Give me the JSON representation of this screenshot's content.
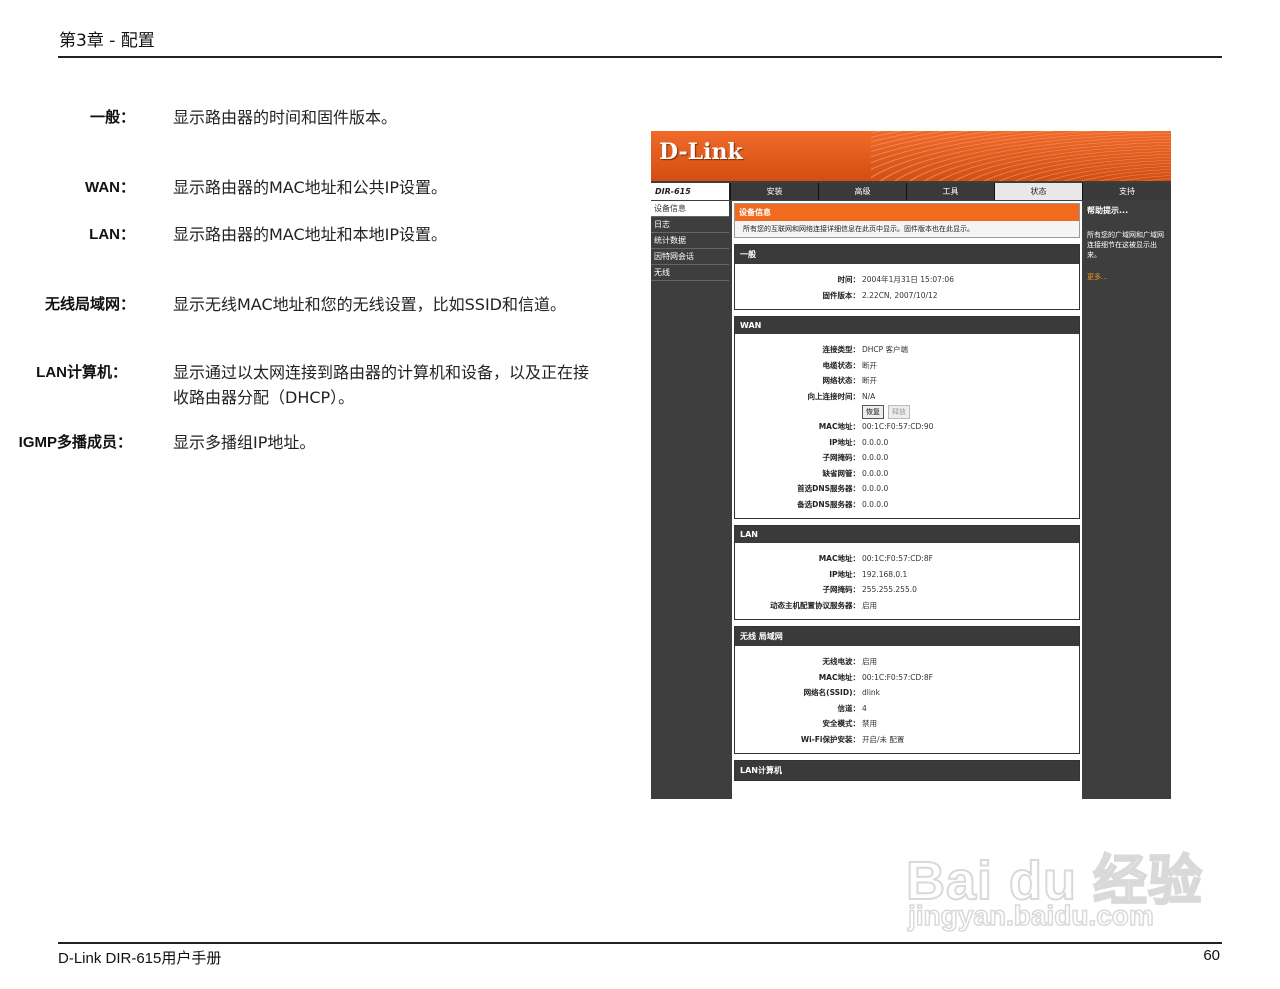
{
  "header": {
    "chapter": "第3章 - 配置"
  },
  "descriptions": [
    {
      "term": "一般：",
      "text": "显示路由器的时间和固件版本。"
    },
    {
      "term": "WAN：",
      "text": "显示路由器的MAC地址和公共IP设置。"
    },
    {
      "term": "LAN：",
      "text": "显示路由器的MAC地址和本地IP设置。"
    },
    {
      "term": "无线局域网：",
      "text": "显示无线MAC地址和您的无线设置，比如SSID和信道。"
    },
    {
      "term": "LAN计算机：",
      "text": "显示通过以太网连接到路由器的计算机和设备，以及正在接收路由器分配（DHCP）。"
    },
    {
      "term": "IGMP多播成员：",
      "text": "显示多播组IP地址。"
    }
  ],
  "router_ui": {
    "logo": "D-Link",
    "model": "DIR-615",
    "tabs": [
      "安装",
      "高级",
      "工具",
      "状态",
      "支持"
    ],
    "active_tab": "状态",
    "menu": [
      "设备信息",
      "日志",
      "统计数据",
      "因特网会话",
      "无线"
    ],
    "info_title": "设备信息",
    "info_text": "所有您的互联网和网络连接详细信息在此页中显示。固件版本也在此显示。",
    "help_title": "帮助提示...",
    "help_text": "所有您的广域网和广域网连接细节在这被显示出来。",
    "help_more": "更多...",
    "general": {
      "title": "一般",
      "rows": [
        {
          "k": "时间：",
          "v": "2004年1月31日 15:07:06"
        },
        {
          "k": "固件版本：",
          "v": "2.22CN, 2007/10/12"
        }
      ]
    },
    "wan": {
      "title": "WAN",
      "rows_top": [
        {
          "k": "连接类型：",
          "v": "DHCP 客户端"
        },
        {
          "k": "电缆状态：",
          "v": "断开"
        },
        {
          "k": "网络状态：",
          "v": "断开"
        },
        {
          "k": "向上连接时间：",
          "v": "N/A"
        }
      ],
      "renew": "恢复",
      "release": "释放",
      "rows_bottom": [
        {
          "k": "MAC地址：",
          "v": "00:1C:F0:57:CD:90"
        },
        {
          "k": "IP地址：",
          "v": "0.0.0.0"
        },
        {
          "k": "子网掩码：",
          "v": "0.0.0.0"
        },
        {
          "k": "缺省网管：",
          "v": "0.0.0.0"
        },
        {
          "k": "首选DNS服务器：",
          "v": "0.0.0.0"
        },
        {
          "k": "备选DNS服务器：",
          "v": "0.0.0.0"
        }
      ]
    },
    "lan": {
      "title": "LAN",
      "rows": [
        {
          "k": "MAC地址：",
          "v": "00:1C:F0:57:CD:8F"
        },
        {
          "k": "IP地址：",
          "v": "192.168.0.1"
        },
        {
          "k": "子网掩码：",
          "v": "255.255.255.0"
        },
        {
          "k": "动态主机配置协议服务器：",
          "v": "启用"
        }
      ]
    },
    "wlan": {
      "title": "无线 局域网",
      "rows": [
        {
          "k": "无线电波：",
          "v": "启用"
        },
        {
          "k": "MAC地址：",
          "v": "00:1C:F0:57:CD:8F"
        },
        {
          "k": "网络名(SSID)：",
          "v": "dlink"
        },
        {
          "k": "信道：",
          "v": "4"
        },
        {
          "k": "安全模式：",
          "v": "禁用"
        },
        {
          "k": "Wi-Fi保护安装：",
          "v": "开启/未 配置"
        }
      ]
    },
    "lan_computers": {
      "title": "LAN计算机"
    }
  },
  "watermark": {
    "main": "Bai du 经验",
    "sub": "jingyan.baidu.com"
  },
  "footer": {
    "left": "D-Link DIR-615用户手册",
    "page": "60"
  }
}
